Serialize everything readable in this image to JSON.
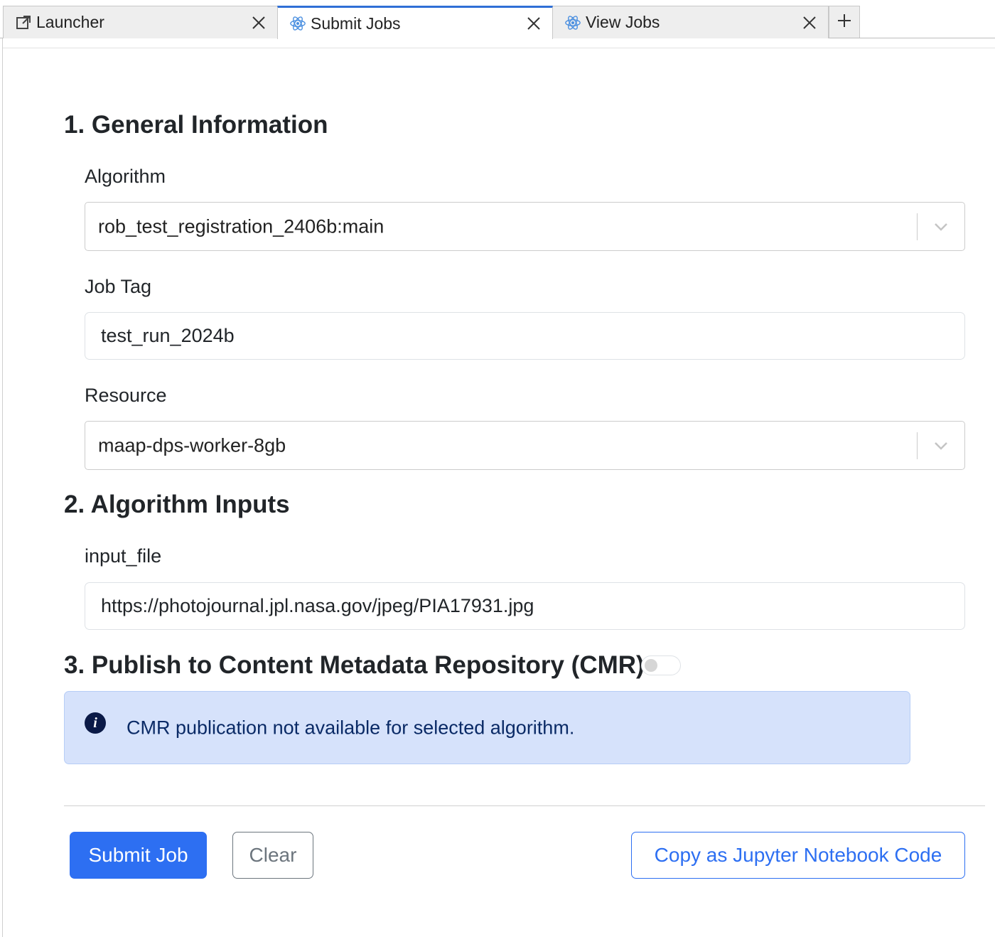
{
  "tabs": [
    {
      "label": "Launcher",
      "icon": "external-link-icon",
      "active": false
    },
    {
      "label": "Submit Jobs",
      "icon": "react-icon",
      "active": true
    },
    {
      "label": "View Jobs",
      "icon": "react-icon",
      "active": false
    }
  ],
  "sections": {
    "general": {
      "title": "1. General Information"
    },
    "inputs": {
      "title": "2. Algorithm Inputs"
    },
    "publish": {
      "title": "3. Publish to Content Metadata Repository (CMR)?"
    }
  },
  "fields": {
    "algorithm": {
      "label": "Algorithm",
      "value": "rob_test_registration_2406b:main"
    },
    "job_tag": {
      "label": "Job Tag",
      "value": "test_run_2024b"
    },
    "resource": {
      "label": "Resource",
      "value": "maap-dps-worker-8gb"
    },
    "input_file": {
      "label": "input_file",
      "value": "https://photojournal.jpl.nasa.gov/jpeg/PIA17931.jpg"
    }
  },
  "publish_toggle": {
    "on": false
  },
  "alert": {
    "icon": "info-icon",
    "text": "CMR publication not available for selected algorithm."
  },
  "buttons": {
    "submit": "Submit Job",
    "clear": "Clear",
    "copy": "Copy as Jupyter Notebook Code"
  },
  "colors": {
    "primary": "#2d6ff2",
    "active_tab_accent": "#2f6fd6",
    "alert_bg": "#d6e2fb",
    "alert_text": "#0a2a66"
  }
}
